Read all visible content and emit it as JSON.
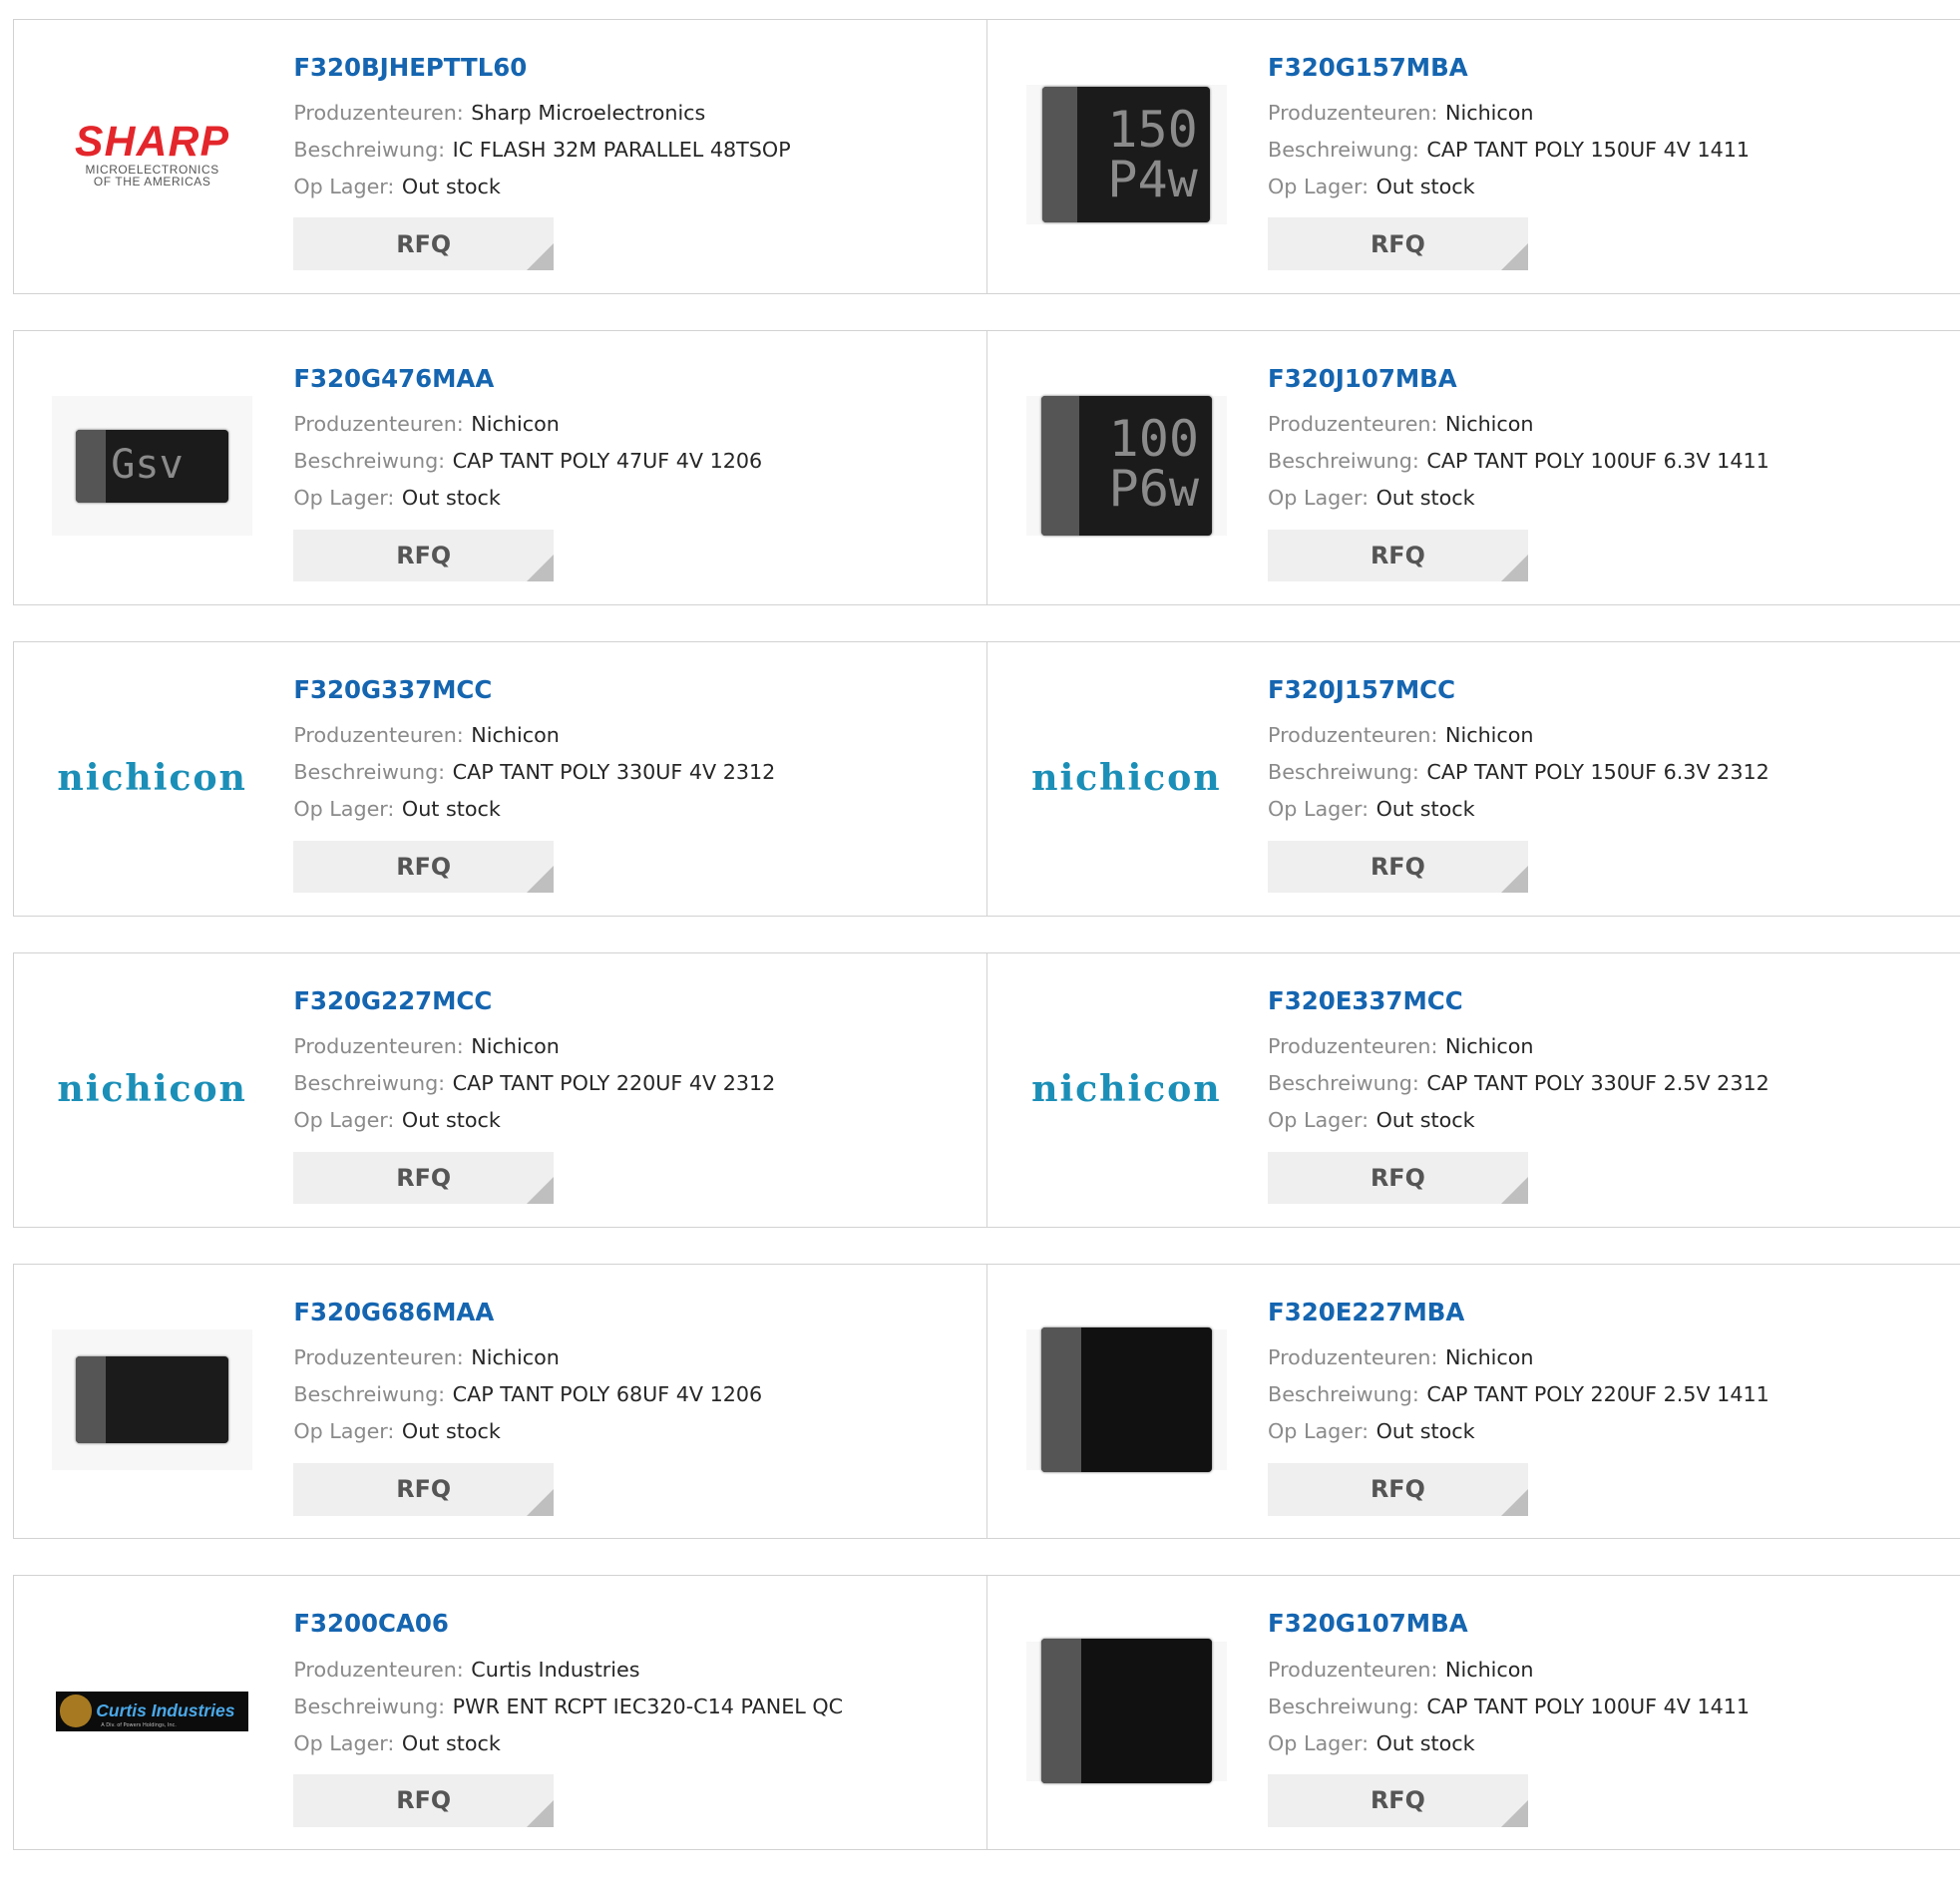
{
  "labels": {
    "manufacturer": "Produzenteuren:",
    "description": "Beschreiwung:",
    "stock": "Op Lager:",
    "rfq": "RFQ"
  },
  "products": [
    {
      "part": "F320BJHEPTTL60",
      "manufacturer": "Sharp Microelectronics",
      "description": "IC FLASH 32M PARALLEL 48TSOP",
      "stock": "Out stock",
      "image": "sharp-logo"
    },
    {
      "part": "F320G157MBA",
      "manufacturer": "Nichicon",
      "description": "CAP TANT POLY 150UF 4V 1411",
      "stock": "Out stock",
      "image": "chip-photo",
      "chip_text": [
        "150",
        "P4w"
      ]
    },
    {
      "part": "F320G476MAA",
      "manufacturer": "Nichicon",
      "description": "CAP TANT POLY 47UF 4V 1206",
      "stock": "Out stock",
      "image": "chip-photo",
      "chip_text": [
        "Gsv"
      ]
    },
    {
      "part": "F320J107MBA",
      "manufacturer": "Nichicon",
      "description": "CAP TANT POLY 100UF 6.3V 1411",
      "stock": "Out stock",
      "image": "chip-photo",
      "chip_text": [
        "100",
        "P6w"
      ]
    },
    {
      "part": "F320G337MCC",
      "manufacturer": "Nichicon",
      "description": "CAP TANT POLY 330UF 4V 2312",
      "stock": "Out stock",
      "image": "nichicon-logo"
    },
    {
      "part": "F320J157MCC",
      "manufacturer": "Nichicon",
      "description": "CAP TANT POLY 150UF 6.3V 2312",
      "stock": "Out stock",
      "image": "nichicon-logo"
    },
    {
      "part": "F320G227MCC",
      "manufacturer": "Nichicon",
      "description": "CAP TANT POLY 220UF 4V 2312",
      "stock": "Out stock",
      "image": "nichicon-logo"
    },
    {
      "part": "F320E337MCC",
      "manufacturer": "Nichicon",
      "description": "CAP TANT POLY 330UF 2.5V 2312",
      "stock": "Out stock",
      "image": "nichicon-logo"
    },
    {
      "part": "F320G686MAA",
      "manufacturer": "Nichicon",
      "description": "CAP TANT POLY 68UF 4V 1206",
      "stock": "Out stock",
      "image": "chip-photo"
    },
    {
      "part": "F320E227MBA",
      "manufacturer": "Nichicon",
      "description": "CAP TANT POLY 220UF 2.5V 1411",
      "stock": "Out stock",
      "image": "chip-photo"
    },
    {
      "part": "F3200CA06",
      "manufacturer": "Curtis Industries",
      "description": "PWR ENT RCPT IEC320-C14 PANEL QC",
      "stock": "Out stock",
      "image": "curtis-logo"
    },
    {
      "part": "F320G107MBA",
      "manufacturer": "Nichicon",
      "description": "CAP TANT POLY 100UF 4V 1411",
      "stock": "Out stock",
      "image": "chip-photo"
    }
  ],
  "logos": {
    "sharp": {
      "name": "SHARP",
      "line1": "MICROELECTRONICS",
      "line2": "OF THE AMERICAS"
    },
    "nichicon": {
      "name": "nichicon"
    },
    "curtis": {
      "name": "Curtis Industries",
      "sub": "A Div. of Powers Holdings, Inc."
    }
  },
  "colors": {
    "link": "#1565b0",
    "label": "#8a8a8a",
    "value": "#262626",
    "border": "#d2d2d2",
    "rfq_bg": "#efefef",
    "sharp_red": "#e3262b",
    "nichicon_blue": "#1b8fb7"
  }
}
